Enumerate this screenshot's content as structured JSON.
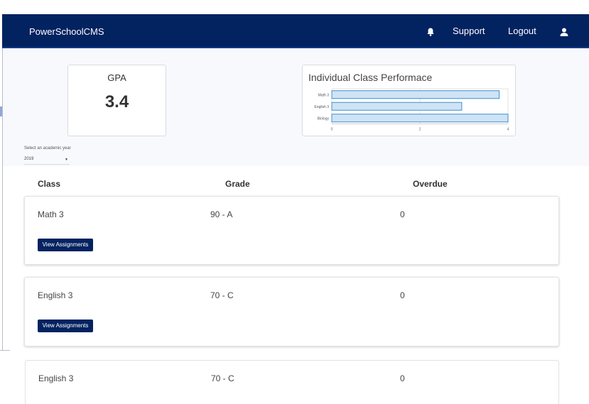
{
  "navbar": {
    "brand": "PowerSchoolCMS",
    "bell_icon": "bell-icon",
    "support": "Support",
    "logout": "Logout",
    "user_icon": "user-icon",
    "bg_color": "#032260"
  },
  "gpa": {
    "label": "GPA",
    "value": "3.4"
  },
  "performance": {
    "title": "Individual Class Performace",
    "chart_data": {
      "type": "bar",
      "orientation": "horizontal",
      "categories": [
        "Math 3",
        "English 3",
        "Biology"
      ],
      "values": [
        3.8,
        2.95,
        4.0
      ],
      "xlim": [
        0,
        4
      ],
      "xticks": [
        "0",
        "2",
        "4"
      ],
      "grid": true,
      "bar_color": "#cfe3f5",
      "bar_edge_color": "#3d8fd1"
    }
  },
  "year_filter": {
    "label": "Select an academic year",
    "selected": "2019"
  },
  "table": {
    "headers": {
      "class": "Class",
      "grade": "Grade",
      "overdue": "Overdue"
    },
    "button_label": "View Assignments",
    "rows": [
      {
        "class": "Math 3",
        "grade": "90 - A",
        "overdue": "0"
      },
      {
        "class": "English 3",
        "grade": "70 - C",
        "overdue": "0"
      },
      {
        "class": "English 3",
        "grade": "70 - C",
        "overdue": "0"
      }
    ]
  }
}
